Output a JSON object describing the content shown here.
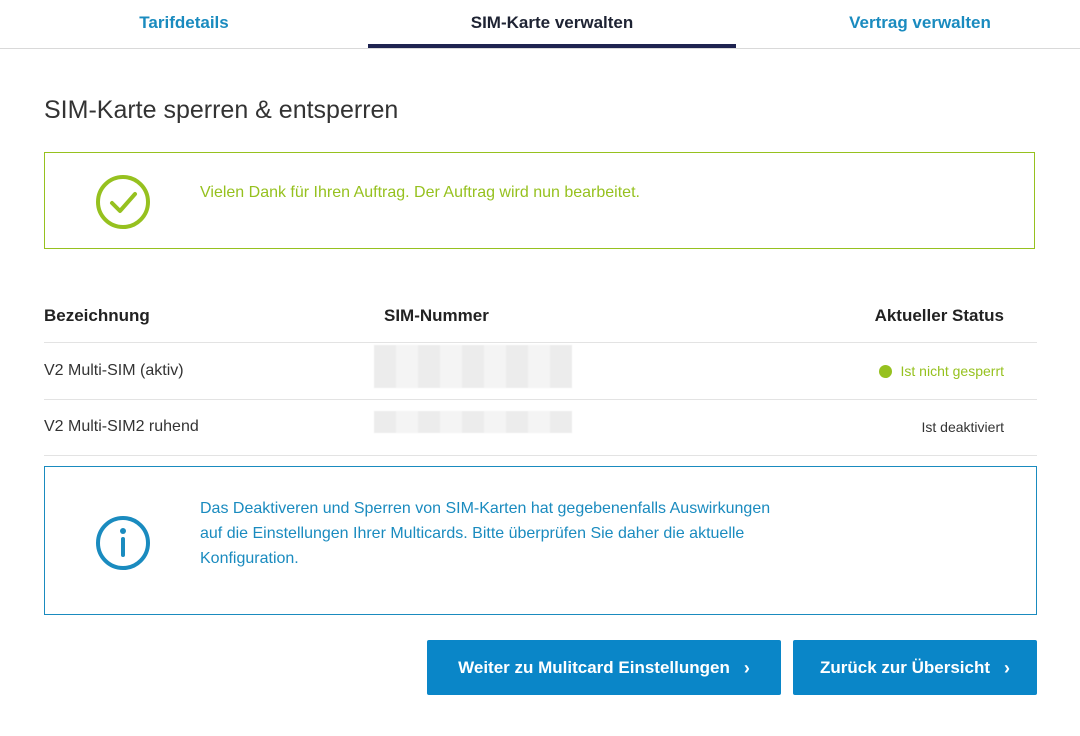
{
  "tabs": [
    {
      "label": "Tarifdetails",
      "active": false
    },
    {
      "label": "SIM-Karte verwalten",
      "active": true
    },
    {
      "label": "Vertrag verwalten",
      "active": false
    }
  ],
  "page_title": "SIM-Karte sperren & entsperren",
  "success_message": {
    "icon": "checkmark-circle-icon",
    "text": "Vielen Dank für Ihren Auftrag. Der Auftrag wird nun bearbeitet."
  },
  "table": {
    "headers": [
      "Bezeichnung",
      "SIM-Nummer",
      "Aktueller Status"
    ],
    "rows": [
      {
        "name": "V2 Multi-SIM (aktiv)",
        "sim": "",
        "status": "Ist nicht gesperrt",
        "status_color": "#96c11f"
      },
      {
        "name": "V2 Multi-SIM2 ruhend",
        "sim": "",
        "status": "Ist deaktiviert",
        "status_color": "#333333"
      }
    ]
  },
  "info_message": {
    "icon": "info-circle-icon",
    "lines": [
      "Das Deaktiveren und Sperren von SIM-Karten hat gegebenenfalls Auswirkungen",
      "auf die Einstellungen Ihrer Multicards. Bitte überprüfen Sie daher die aktuelle",
      "Konfiguration."
    ]
  },
  "buttons": {
    "multicard": "Weiter zu Mulitcard Einstellungen",
    "overview": "Zurück zur Übersicht"
  },
  "colors": {
    "accent": "#1a8bbf",
    "success": "#96c11f",
    "button": "#0a86c8",
    "tab_active_underline": "#1e2350"
  }
}
